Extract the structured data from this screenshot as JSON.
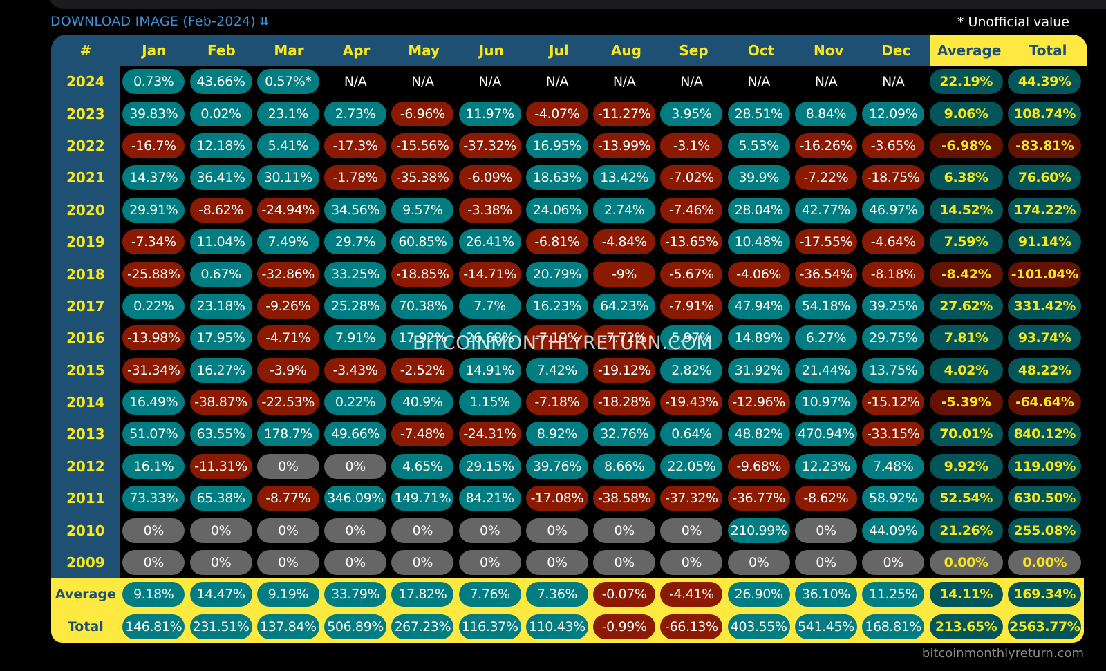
{
  "header": {
    "download_label": "DOWNLOAD IMAGE (Feb-2024)",
    "download_icon": "double-chevron-down-icon",
    "note": "* Unofficial value"
  },
  "columns": {
    "year": "#",
    "months": [
      "Jan",
      "Feb",
      "Mar",
      "Apr",
      "May",
      "Jun",
      "Jul",
      "Aug",
      "Sep",
      "Oct",
      "Nov",
      "Dec"
    ],
    "average": "Average",
    "total": "Total"
  },
  "rows": [
    {
      "year": "2024",
      "months": [
        "0.73%",
        "43.66%",
        "0.57%*",
        "N/A",
        "N/A",
        "N/A",
        "N/A",
        "N/A",
        "N/A",
        "N/A",
        "N/A",
        "N/A"
      ],
      "average": "22.19%",
      "total": "44.39%"
    },
    {
      "year": "2023",
      "months": [
        "39.83%",
        "0.02%",
        "23.1%",
        "2.73%",
        "-6.96%",
        "11.97%",
        "-4.07%",
        "-11.27%",
        "3.95%",
        "28.51%",
        "8.84%",
        "12.09%"
      ],
      "average": "9.06%",
      "total": "108.74%"
    },
    {
      "year": "2022",
      "months": [
        "-16.7%",
        "12.18%",
        "5.41%",
        "-17.3%",
        "-15.56%",
        "-37.32%",
        "16.95%",
        "-13.99%",
        "-3.1%",
        "5.53%",
        "-16.26%",
        "-3.65%"
      ],
      "average": "-6.98%",
      "total": "-83.81%"
    },
    {
      "year": "2021",
      "months": [
        "14.37%",
        "36.41%",
        "30.11%",
        "-1.78%",
        "-35.38%",
        "-6.09%",
        "18.63%",
        "13.42%",
        "-7.02%",
        "39.9%",
        "-7.22%",
        "-18.75%"
      ],
      "average": "6.38%",
      "total": "76.60%"
    },
    {
      "year": "2020",
      "months": [
        "29.91%",
        "-8.62%",
        "-24.94%",
        "34.56%",
        "9.57%",
        "-3.38%",
        "24.06%",
        "2.74%",
        "-7.46%",
        "28.04%",
        "42.77%",
        "46.97%"
      ],
      "average": "14.52%",
      "total": "174.22%"
    },
    {
      "year": "2019",
      "months": [
        "-7.34%",
        "11.04%",
        "7.49%",
        "29.7%",
        "60.85%",
        "26.41%",
        "-6.81%",
        "-4.84%",
        "-13.65%",
        "10.48%",
        "-17.55%",
        "-4.64%"
      ],
      "average": "7.59%",
      "total": "91.14%"
    },
    {
      "year": "2018",
      "months": [
        "-25.88%",
        "0.67%",
        "-32.86%",
        "33.25%",
        "-18.85%",
        "-14.71%",
        "20.79%",
        "-9%",
        "-5.67%",
        "-4.06%",
        "-36.54%",
        "-8.18%"
      ],
      "average": "-8.42%",
      "total": "-101.04%"
    },
    {
      "year": "2017",
      "months": [
        "0.22%",
        "23.18%",
        "-9.26%",
        "25.28%",
        "70.38%",
        "7.7%",
        "16.23%",
        "64.23%",
        "-7.91%",
        "47.94%",
        "54.18%",
        "39.25%"
      ],
      "average": "27.62%",
      "total": "331.42%"
    },
    {
      "year": "2016",
      "months": [
        "-13.98%",
        "17.95%",
        "-4.71%",
        "7.91%",
        "17.92%",
        "26.68%",
        "-7.19%",
        "-7.72%",
        "5.97%",
        "14.89%",
        "6.27%",
        "29.75%"
      ],
      "average": "7.81%",
      "total": "93.74%"
    },
    {
      "year": "2015",
      "months": [
        "-31.34%",
        "16.27%",
        "-3.9%",
        "-3.43%",
        "-2.52%",
        "14.91%",
        "7.42%",
        "-19.12%",
        "2.82%",
        "31.92%",
        "21.44%",
        "13.75%"
      ],
      "average": "4.02%",
      "total": "48.22%"
    },
    {
      "year": "2014",
      "months": [
        "16.49%",
        "-38.87%",
        "-22.53%",
        "0.22%",
        "40.9%",
        "1.15%",
        "-7.18%",
        "-18.28%",
        "-19.43%",
        "-12.96%",
        "10.97%",
        "-15.12%"
      ],
      "average": "-5.39%",
      "total": "-64.64%"
    },
    {
      "year": "2013",
      "months": [
        "51.07%",
        "63.55%",
        "178.7%",
        "49.66%",
        "-7.48%",
        "-24.31%",
        "8.92%",
        "32.76%",
        "0.64%",
        "48.82%",
        "470.94%",
        "-33.15%"
      ],
      "average": "70.01%",
      "total": "840.12%"
    },
    {
      "year": "2012",
      "months": [
        "16.1%",
        "-11.31%",
        "0%",
        "0%",
        "4.65%",
        "29.15%",
        "39.76%",
        "8.66%",
        "22.05%",
        "-9.68%",
        "12.23%",
        "7.48%"
      ],
      "average": "9.92%",
      "total": "119.09%"
    },
    {
      "year": "2011",
      "months": [
        "73.33%",
        "65.38%",
        "-8.77%",
        "346.09%",
        "149.71%",
        "84.21%",
        "-17.08%",
        "-38.58%",
        "-37.32%",
        "-36.77%",
        "-8.62%",
        "58.92%"
      ],
      "average": "52.54%",
      "total": "630.50%"
    },
    {
      "year": "2010",
      "months": [
        "0%",
        "0%",
        "0%",
        "0%",
        "0%",
        "0%",
        "0%",
        "0%",
        "0%",
        "210.99%",
        "0%",
        "44.09%"
      ],
      "average": "21.26%",
      "total": "255.08%"
    },
    {
      "year": "2009",
      "months": [
        "0%",
        "0%",
        "0%",
        "0%",
        "0%",
        "0%",
        "0%",
        "0%",
        "0%",
        "0%",
        "0%",
        "0%"
      ],
      "average": "0.00%",
      "total": "0.00%"
    }
  ],
  "footer_rows": [
    {
      "label": "Average",
      "months": [
        "9.18%",
        "14.47%",
        "9.19%",
        "33.79%",
        "17.82%",
        "7.76%",
        "7.36%",
        "-0.07%",
        "-4.41%",
        "26.90%",
        "36.10%",
        "11.25%"
      ],
      "average": "14.11%",
      "total": "169.34%"
    },
    {
      "label": "Total",
      "months": [
        "146.81%",
        "231.51%",
        "137.84%",
        "506.89%",
        "267.23%",
        "116.37%",
        "110.43%",
        "-0.99%",
        "-66.13%",
        "403.55%",
        "541.45%",
        "168.81%"
      ],
      "average": "213.65%",
      "total": "2563.77%"
    }
  ],
  "colors": {
    "positive": "#017c80",
    "negative": "#8a1a02",
    "zero": "#666666",
    "summary_positive": "#025558",
    "summary_negative": "#641300",
    "header_blue": "#1d5072",
    "header_yellow": "#fde940",
    "year_text": "#f8e71c",
    "link_blue": "#3d8fd6"
  },
  "watermark": "BITCOINMONTHLYRETURN.COM",
  "credit": "bitcoinmonthlyreturn.com"
}
